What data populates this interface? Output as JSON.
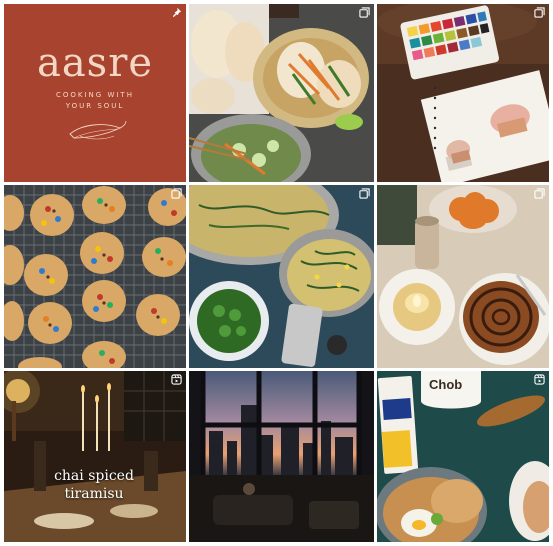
{
  "profile_grid": {
    "brand": {
      "name": "aasre",
      "tagline_line1": "COOKING WITH",
      "tagline_line2": "YOUR SOUL",
      "pin_icon": "pin-icon",
      "background": "#a8432f"
    },
    "posts": [
      {
        "id": "post-bao-buns",
        "badge_icon": "carousel-icon"
      },
      {
        "id": "post-watercolor",
        "badge_icon": "carousel-icon"
      },
      {
        "id": "post-cookies",
        "badge_icon": "carousel-icon"
      },
      {
        "id": "post-curry-soup",
        "badge_icon": "carousel-icon"
      },
      {
        "id": "post-cinnamon-roll",
        "badge_icon": "carousel-icon"
      },
      {
        "id": "post-tiramisu",
        "badge_icon": "reel-icon",
        "overlay_line1": "chai spiced",
        "overlay_line2": "tiramisu"
      },
      {
        "id": "post-sunset-window",
        "badge_icon": "none"
      },
      {
        "id": "post-breakfast",
        "badge_icon": "reel-icon",
        "cup_text": "Chob",
        "box_text": "Cabot"
      }
    ]
  }
}
